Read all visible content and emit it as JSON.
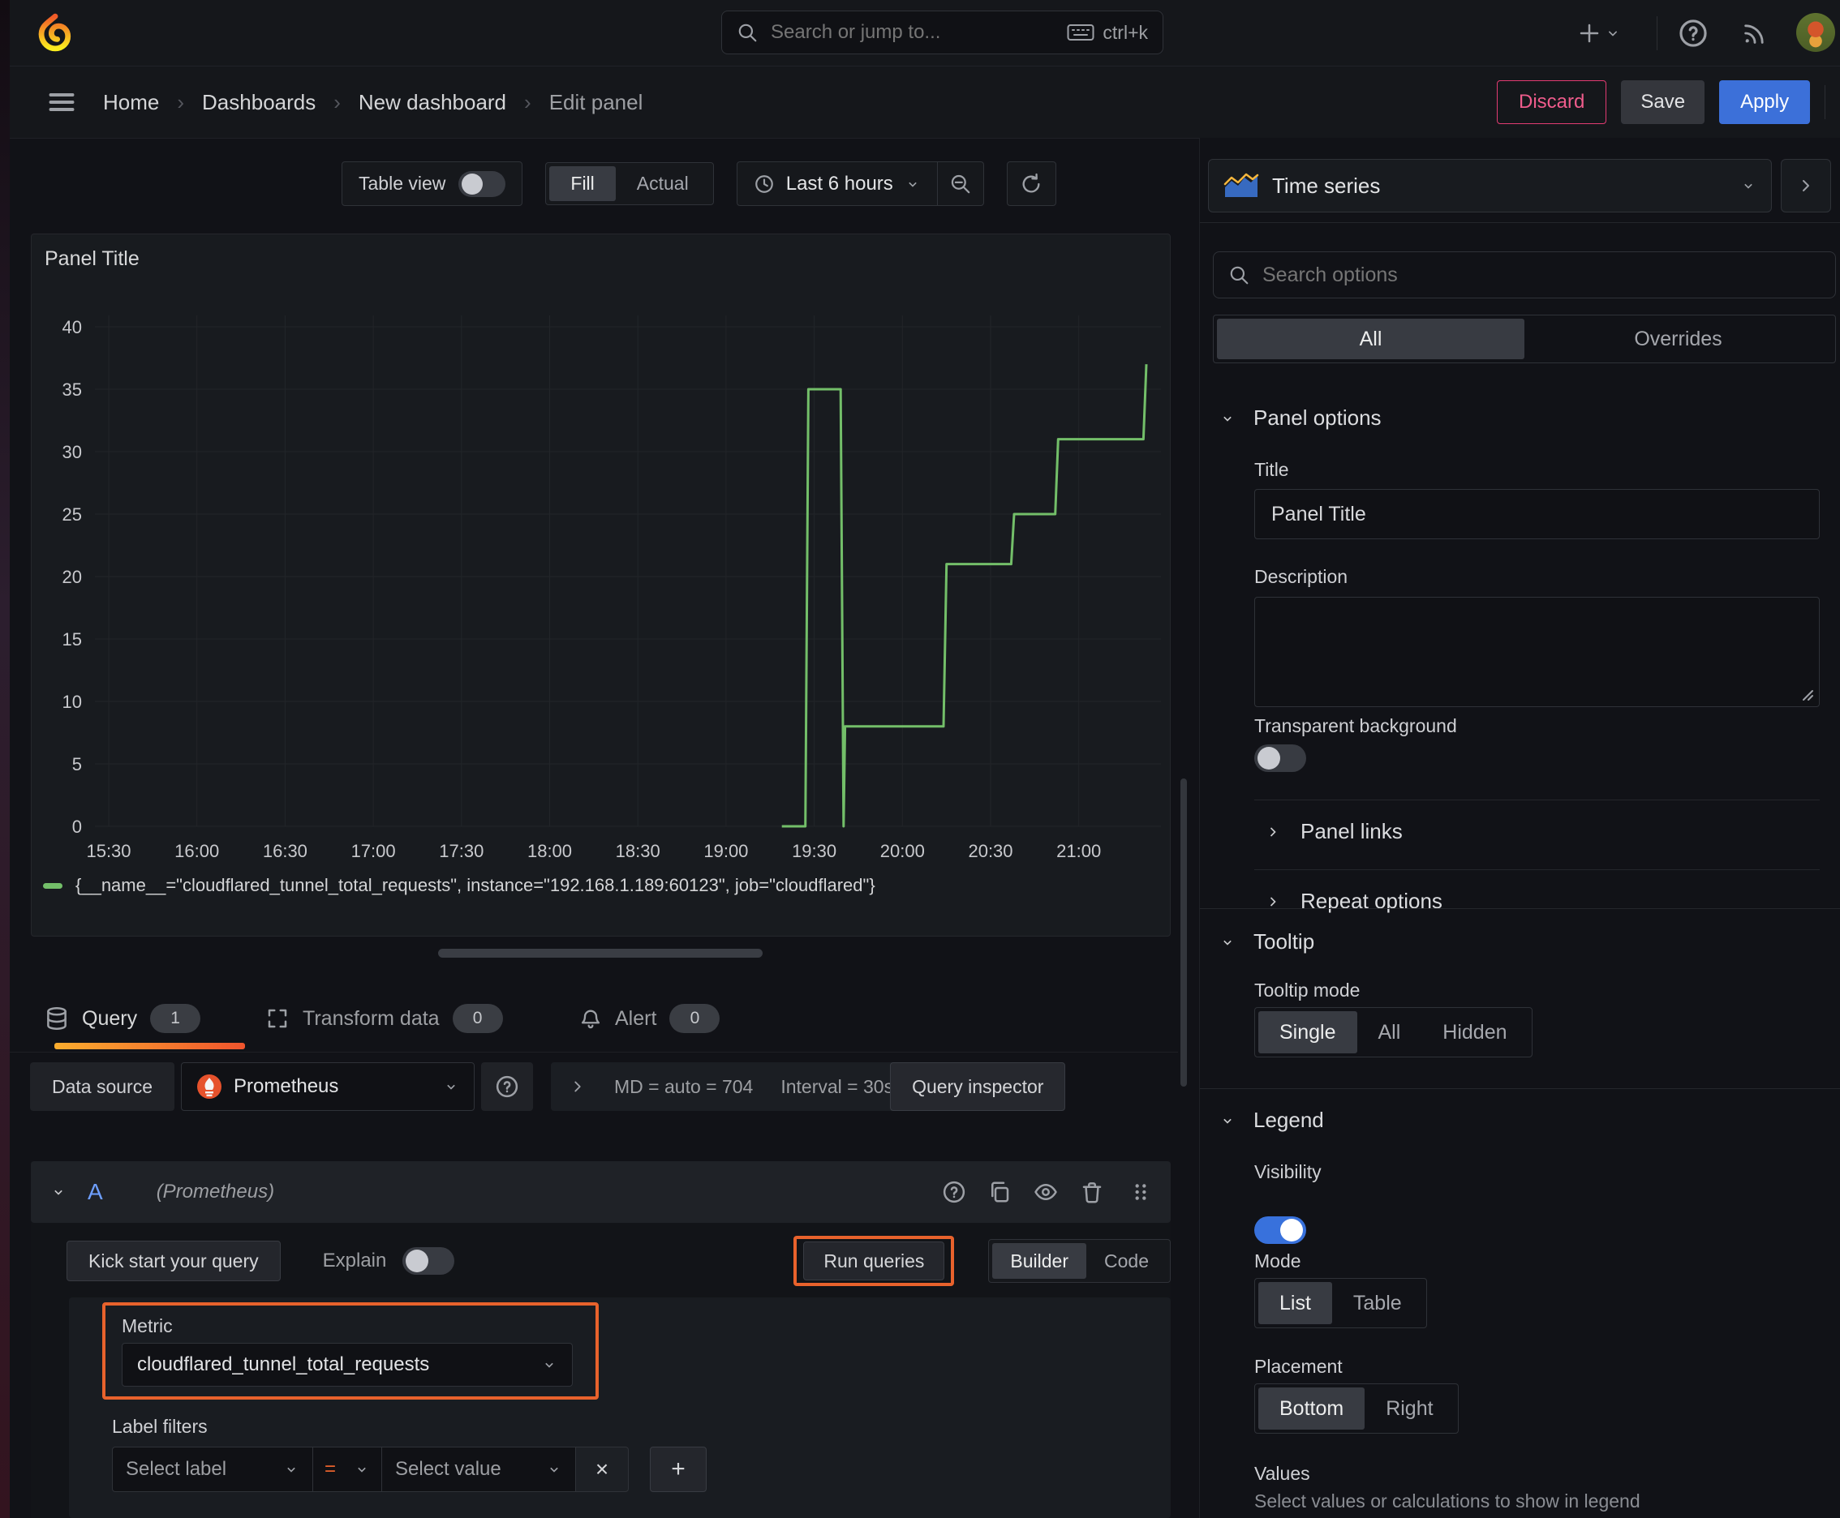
{
  "colors": {
    "accent_orange": "#e8622c",
    "series_green": "#73bf69",
    "primary_blue": "#3871dc",
    "danger_pink": "#e23b72"
  },
  "icons": {
    "question": "?",
    "close": "×",
    "add": "+",
    "equals": "=",
    "breadcrumb_sep": "›"
  },
  "topbar": {
    "search_placeholder": "Search or jump to...",
    "search_shortcut": "ctrl+k"
  },
  "breadcrumb": {
    "items": [
      {
        "label": "Home"
      },
      {
        "label": "Dashboards"
      },
      {
        "label": "New dashboard"
      },
      {
        "label": "Edit panel"
      }
    ]
  },
  "actions": {
    "discard": "Discard",
    "save": "Save",
    "apply": "Apply"
  },
  "panel_controls": {
    "table_view": "Table view",
    "fill": "Fill",
    "actual": "Actual",
    "time_range": "Last 6 hours"
  },
  "panel": {
    "title": "Panel Title",
    "legend": "{__name__=\"cloudflared_tunnel_total_requests\", instance=\"192.168.1.189:60123\", job=\"cloudflared\"}"
  },
  "chart_data": {
    "type": "line",
    "title": "Panel Title",
    "x_ticks": [
      "15:30",
      "16:00",
      "16:30",
      "17:00",
      "17:30",
      "18:00",
      "18:30",
      "19:00",
      "19:30",
      "20:00",
      "20:30",
      "21:00"
    ],
    "x_minutes_per_tick": 30,
    "y_ticks": [
      0,
      5,
      10,
      15,
      20,
      25,
      30,
      35,
      40
    ],
    "ylim": [
      0,
      40
    ],
    "xlim_minutes": [
      0,
      357
    ],
    "grid": true,
    "legend_position": "bottom",
    "series": [
      {
        "name": "{__name__=\"cloudflared_tunnel_total_requests\", instance=\"192.168.1.189:60123\", job=\"cloudflared\"}",
        "color": "#73bf69",
        "points_minutes_value": [
          [
            229,
            0
          ],
          [
            237,
            0
          ],
          [
            238,
            35
          ],
          [
            249,
            35
          ],
          [
            250,
            0
          ],
          [
            250.5,
            8
          ],
          [
            284,
            8
          ],
          [
            285,
            21
          ],
          [
            307,
            21
          ],
          [
            308,
            25
          ],
          [
            322,
            25
          ],
          [
            323,
            31
          ],
          [
            352,
            31
          ],
          [
            353,
            37
          ]
        ]
      }
    ]
  },
  "query_tabs": {
    "query": "Query",
    "query_count": "1",
    "transform": "Transform data",
    "transform_count": "0",
    "alert": "Alert",
    "alert_count": "0"
  },
  "datasource_row": {
    "label": "Data source",
    "value": "Prometheus",
    "stats_md": "MD = auto = 704",
    "stats_interval": "Interval = 30s",
    "inspector": "Query inspector"
  },
  "query_editor": {
    "ref_id": "A",
    "ds_hint": "(Prometheus)",
    "kick_start": "Kick start your query",
    "explain": "Explain",
    "run_queries": "Run queries",
    "builder": "Builder",
    "code": "Code",
    "metric_label": "Metric",
    "metric_value": "cloudflared_tunnel_total_requests",
    "label_filters": "Label filters",
    "select_label": "Select label",
    "operator": "=",
    "select_value": "Select value"
  },
  "sidebar": {
    "viz": "Time series",
    "search_placeholder": "Search options",
    "tabs": {
      "all": "All",
      "overrides": "Overrides"
    },
    "panel_options": {
      "title": "Panel options",
      "title_label": "Title",
      "title_value": "Panel Title",
      "description_label": "Description",
      "transparent_label": "Transparent background"
    },
    "collapsed": {
      "panel_links": "Panel links",
      "repeat_options": "Repeat options"
    },
    "tooltip": {
      "title": "Tooltip",
      "mode_label": "Tooltip mode",
      "modes": [
        "Single",
        "All",
        "Hidden"
      ]
    },
    "legend": {
      "title": "Legend",
      "visibility_label": "Visibility",
      "mode_label": "Mode",
      "modes": [
        "List",
        "Table"
      ],
      "placement_label": "Placement",
      "placements": [
        "Bottom",
        "Right"
      ],
      "values_label": "Values",
      "values_hint": "Select values or calculations to show in legend"
    }
  }
}
